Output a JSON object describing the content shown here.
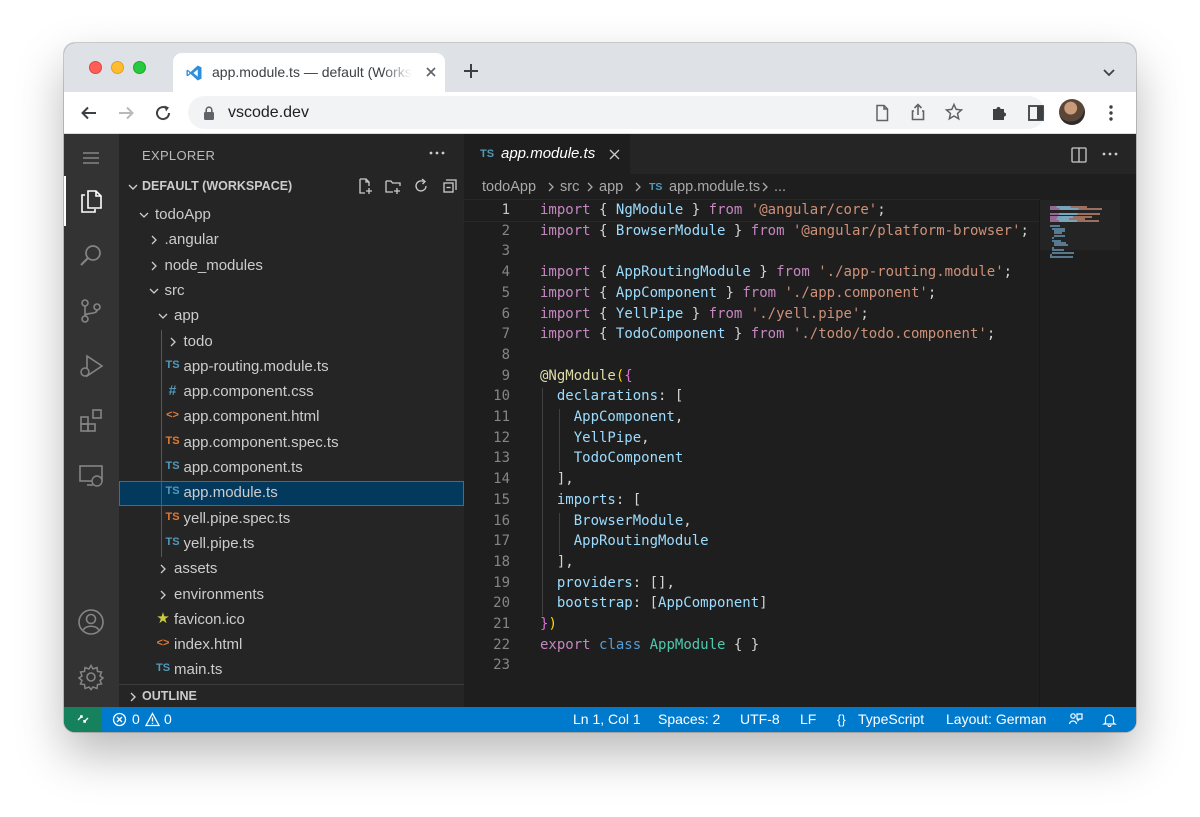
{
  "browser": {
    "tab_title": "app.module.ts — default (Workspace)",
    "url": "vscode.dev"
  },
  "explorer": {
    "header": "EXPLORER",
    "workspace_label": "DEFAULT (WORKSPACE)",
    "outline_label": "OUTLINE",
    "tree": [
      {
        "name": "todoApp",
        "kind": "folder-open"
      },
      {
        "name": ".angular",
        "kind": "folder"
      },
      {
        "name": "node_modules",
        "kind": "folder"
      },
      {
        "name": "src",
        "kind": "folder-open"
      },
      {
        "name": "app",
        "kind": "folder-open"
      },
      {
        "name": "todo",
        "kind": "folder"
      },
      {
        "name": "app-routing.module.ts",
        "kind": "ts",
        "badge": "TS"
      },
      {
        "name": "app.component.css",
        "kind": "css",
        "badge": "#"
      },
      {
        "name": "app.component.html",
        "kind": "html",
        "badge": "<>"
      },
      {
        "name": "app.component.spec.ts",
        "kind": "ts-spec",
        "badge": "TS"
      },
      {
        "name": "app.component.ts",
        "kind": "ts",
        "badge": "TS"
      },
      {
        "name": "app.module.ts",
        "kind": "ts",
        "badge": "TS",
        "selected": true
      },
      {
        "name": "yell.pipe.spec.ts",
        "kind": "ts-spec",
        "badge": "TS"
      },
      {
        "name": "yell.pipe.ts",
        "kind": "ts",
        "badge": "TS"
      },
      {
        "name": "assets",
        "kind": "folder"
      },
      {
        "name": "environments",
        "kind": "folder"
      },
      {
        "name": "favicon.ico",
        "kind": "ico",
        "badge": "★"
      },
      {
        "name": "index.html",
        "kind": "html",
        "badge": "<>"
      },
      {
        "name": "main.ts",
        "kind": "ts",
        "badge": "TS"
      }
    ]
  },
  "editor": {
    "tab_badge": "TS",
    "tab_label": "app.module.ts",
    "breadcrumbs": [
      "todoApp",
      "src",
      "app",
      "app.module.ts",
      "..."
    ],
    "breadcrumb_badge": "TS",
    "line_numbers": [
      "1",
      "2",
      "3",
      "4",
      "5",
      "6",
      "7",
      "8",
      "9",
      "10",
      "11",
      "12",
      "13",
      "14",
      "15",
      "16",
      "17",
      "18",
      "19",
      "20",
      "21",
      "22",
      "23"
    ],
    "code_lines": [
      "import { NgModule } from '@angular/core';",
      "import { BrowserModule } from '@angular/platform-browser';",
      "",
      "import { AppRoutingModule } from './app-routing.module';",
      "import { AppComponent } from './app.component';",
      "import { YellPipe } from './yell.pipe';",
      "import { TodoComponent } from './todo/todo.component';",
      "",
      "@NgModule({",
      "  declarations: [",
      "    AppComponent,",
      "    YellPipe,",
      "    TodoComponent",
      "  ],",
      "  imports: [",
      "    BrowserModule,",
      "    AppRoutingModule",
      "  ],",
      "  providers: [],",
      "  bootstrap: [AppComponent]",
      "})",
      "export class AppModule { }",
      ""
    ]
  },
  "statusbar": {
    "errors": "0",
    "warnings": "0",
    "position": "Ln 1, Col 1",
    "spaces": "Spaces: 2",
    "encoding": "UTF-8",
    "eol": "LF",
    "language": "TypeScript",
    "layout": "Layout: German"
  },
  "colors": {
    "statusbar": "#007acc",
    "remote": "#16825d",
    "selection": "#04395e",
    "ts_icon": "#519aba",
    "ts_spec_icon": "#e37933",
    "html_icon": "#e37933",
    "css_icon": "#519aba",
    "favicon_icon": "#cbcb41"
  }
}
